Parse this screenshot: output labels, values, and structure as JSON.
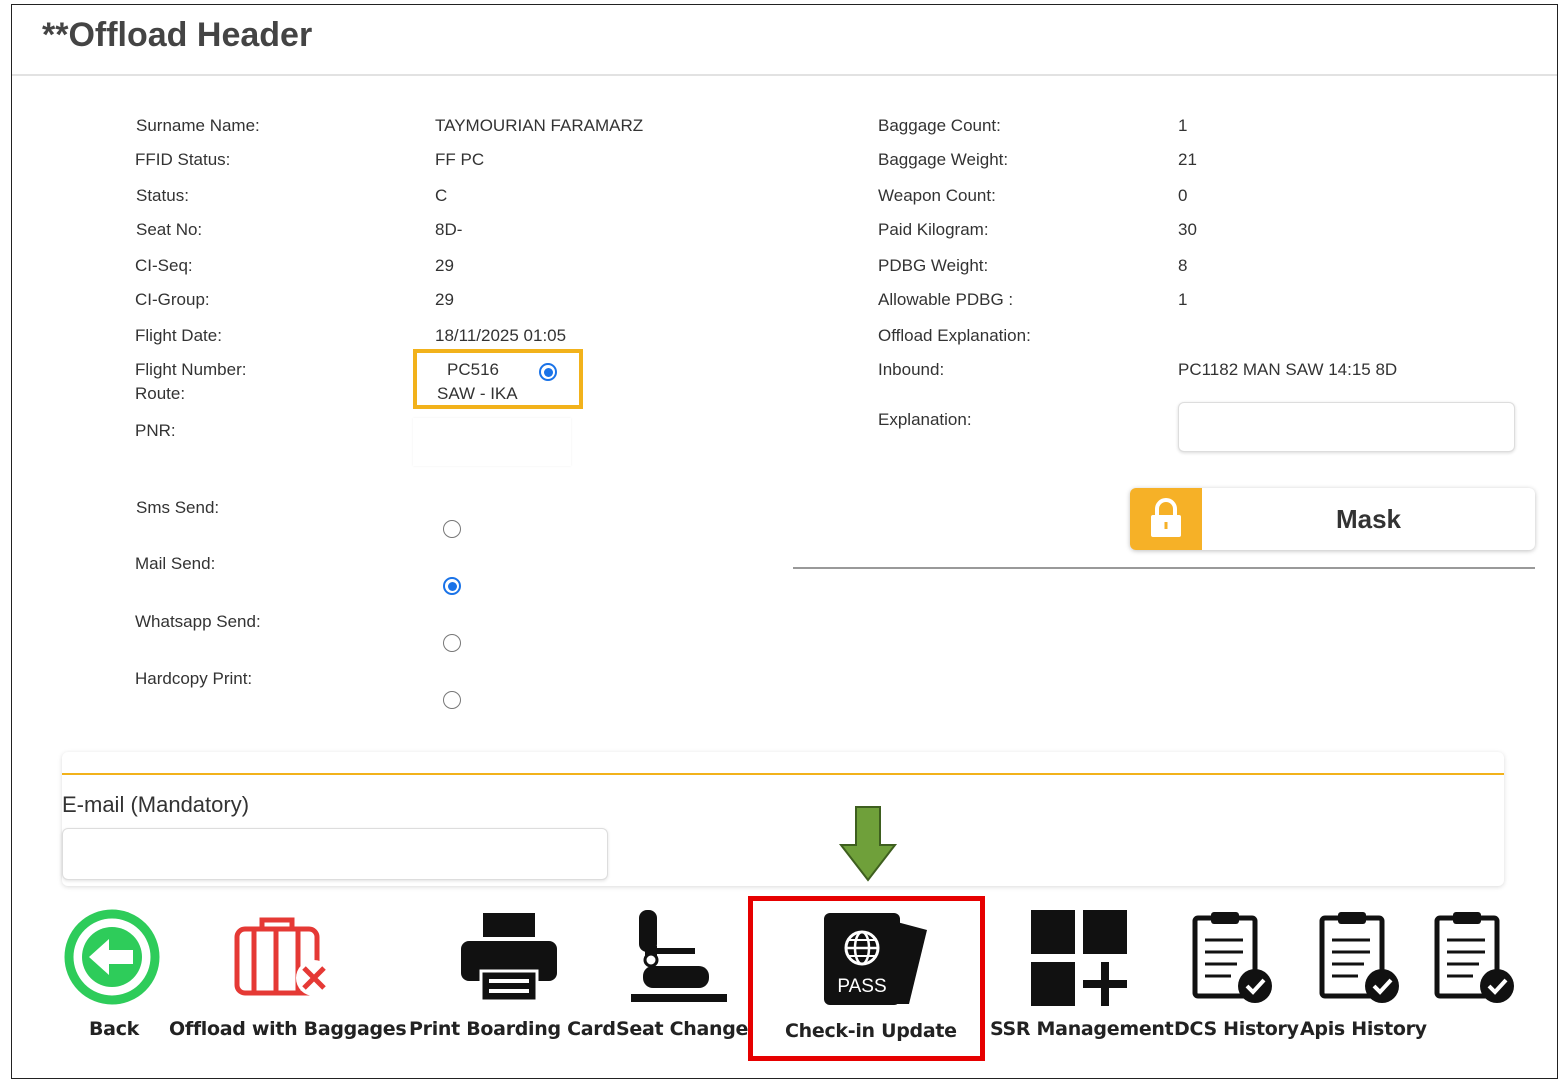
{
  "header": {
    "title": "**Offload Header"
  },
  "details_left": [
    {
      "label": "Surname Name:",
      "value": "TAYMOURIAN FARAMARZ"
    },
    {
      "label": "FFID Status:",
      "value": "FF PC"
    },
    {
      "label": "Status:",
      "value": "C"
    },
    {
      "label": "Seat No:",
      "value": "8D-"
    },
    {
      "label": "CI-Seq:",
      "value": "29"
    },
    {
      "label": "CI-Group:",
      "value": "29"
    },
    {
      "label": "Flight Date:",
      "value": "18/11/2025 01:05"
    }
  ],
  "flight": {
    "number_label": "Flight Number:",
    "route_label": "Route:",
    "number": "PC516",
    "route": "SAW - IKA",
    "selected": true
  },
  "pnr": {
    "label": "PNR:",
    "value": ""
  },
  "details_right": [
    {
      "label": "Baggage Count:",
      "value": "1"
    },
    {
      "label": "Baggage Weight:",
      "value": "21"
    },
    {
      "label": "Weapon Count:",
      "value": "0"
    },
    {
      "label": "Paid Kilogram:",
      "value": "30"
    },
    {
      "label": "PDBG Weight:",
      "value": "8"
    },
    {
      "label": "Allowable PDBG :",
      "value": "1"
    },
    {
      "label": "Offload Explanation:",
      "value": ""
    },
    {
      "label": "Inbound:",
      "value": "PC1182 MAN SAW 14:15 8D"
    }
  ],
  "explanation": {
    "label": "Explanation:",
    "value": ""
  },
  "mask_button": {
    "label": "Mask",
    "icon": "lock-icon",
    "accent": "#f6b127"
  },
  "send_options": [
    {
      "label": "Sms Send:",
      "checked": false
    },
    {
      "label": "Mail Send:",
      "checked": true
    },
    {
      "label": "Whatsapp Send:",
      "checked": false
    },
    {
      "label": "Hardcopy Print:",
      "checked": false
    }
  ],
  "email": {
    "label": "E-mail (Mandatory)",
    "value": ""
  },
  "toolbar": [
    {
      "label": "Back",
      "icon": "back-arrow-icon"
    },
    {
      "label": "Offload with Baggages",
      "icon": "offload-baggage-icon"
    },
    {
      "label": "Print Boarding Card",
      "icon": "printer-icon"
    },
    {
      "label": "Seat Change",
      "icon": "seat-icon"
    },
    {
      "label": "Check-in Update",
      "icon": "passport-icon",
      "icon_text": "PASS"
    },
    {
      "label": "SSR Management",
      "icon": "ssr-grid-icon"
    },
    {
      "label": "DCS History",
      "icon": "checklist-icon"
    },
    {
      "label": "Apis History",
      "icon": "checklist-icon"
    },
    {
      "label": "",
      "icon": "checklist-icon"
    }
  ],
  "colors": {
    "highlight_red": "#e60000",
    "highlight_yellow": "#f2b21b",
    "arrow_green": "#6fa03a",
    "radio_blue": "#1a73e8",
    "back_green": "#2ecc5a",
    "offload_red": "#e53935"
  }
}
